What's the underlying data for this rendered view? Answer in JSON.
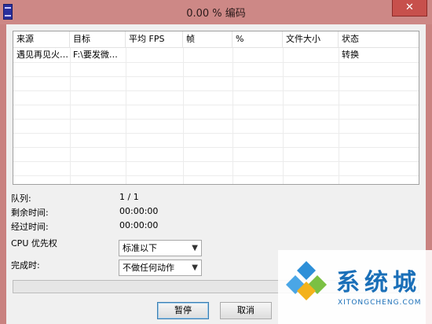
{
  "window": {
    "title": "0.00 % 编码",
    "close_glyph": "✕"
  },
  "table": {
    "columns": [
      "来源",
      "目标",
      "平均 FPS",
      "帧",
      "%",
      "文件大小",
      "状态"
    ],
    "rows": [
      {
        "source": "遇见再见火…",
        "target": "F:\\要发微…",
        "avg_fps": "",
        "frames": "",
        "percent": "",
        "file_size": "",
        "status": "转换"
      }
    ]
  },
  "info": {
    "queue_label": "队列:",
    "queue_value": "1 / 1",
    "remaining_label": "剩余时间:",
    "remaining_value": "00:00:00",
    "elapsed_label": "经过时间:",
    "elapsed_value": "00:00:00",
    "cpu_label": "CPU 优先权",
    "cpu_value": "标准以下",
    "done_label": "完成时:",
    "done_value": "不做任何动作"
  },
  "progress": {
    "fraction": 0.0
  },
  "buttons": {
    "pause": "暂停",
    "cancel": "取消"
  },
  "watermark": {
    "main": "系统城",
    "sub": "XITONGCHENG.COM"
  },
  "colors": {
    "title_bar": "#cd8886",
    "close": "#c7504c",
    "accent": "#1a6fb8"
  }
}
